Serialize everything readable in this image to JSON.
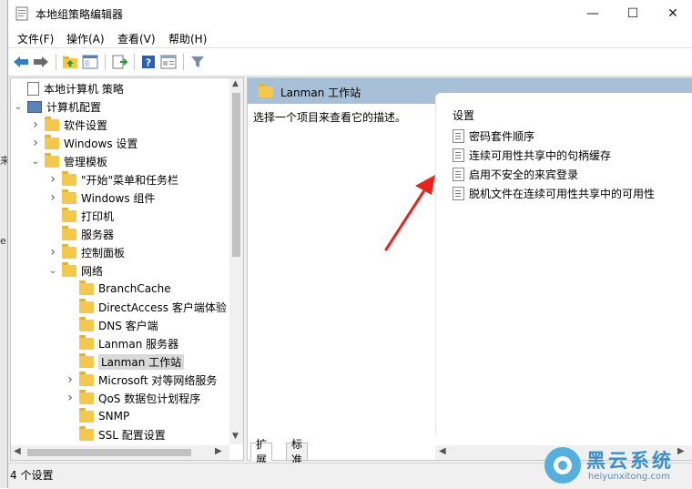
{
  "window": {
    "title": "本地组策略编辑器",
    "minimize_glyph": "—",
    "maximize_glyph": "☐",
    "close_glyph": "✕"
  },
  "menu": [
    "文件(F)",
    "操作(A)",
    "查看(V)",
    "帮助(H)"
  ],
  "toolbar_icons": [
    "back-icon",
    "forward-icon",
    "up-folder-icon",
    "show-hide-tree-icon",
    "export-list-icon",
    "help-icon",
    "properties-icon",
    "filter-icon"
  ],
  "left_strip_fragments": [
    "来",
    "e"
  ],
  "tree": {
    "nodes": [
      {
        "label": "本地计算机 策略",
        "depth": 0,
        "chevron": "",
        "icon": "policy-doc-icon"
      },
      {
        "label": "计算机配置",
        "depth": 0,
        "chevron": "v",
        "icon": "computer-icon"
      },
      {
        "label": "软件设置",
        "depth": 1,
        "chevron": ">",
        "icon": "folder-icon"
      },
      {
        "label": "Windows 设置",
        "depth": 1,
        "chevron": ">",
        "icon": "folder-icon"
      },
      {
        "label": "管理模板",
        "depth": 1,
        "chevron": "v",
        "icon": "folder-icon"
      },
      {
        "label": "\"开始\"菜单和任务栏",
        "depth": 2,
        "chevron": ">",
        "icon": "folder-icon"
      },
      {
        "label": "Windows 组件",
        "depth": 2,
        "chevron": ">",
        "icon": "folder-icon"
      },
      {
        "label": "打印机",
        "depth": 2,
        "chevron": "",
        "icon": "folder-icon"
      },
      {
        "label": "服务器",
        "depth": 2,
        "chevron": "",
        "icon": "folder-icon"
      },
      {
        "label": "控制面板",
        "depth": 2,
        "chevron": ">",
        "icon": "folder-icon"
      },
      {
        "label": "网络",
        "depth": 2,
        "chevron": "v",
        "icon": "folder-icon"
      },
      {
        "label": "BranchCache",
        "depth": 3,
        "chevron": "",
        "icon": "folder-icon"
      },
      {
        "label": "DirectAccess 客户端体验",
        "depth": 3,
        "chevron": "",
        "icon": "folder-icon"
      },
      {
        "label": "DNS 客户端",
        "depth": 3,
        "chevron": "",
        "icon": "folder-icon"
      },
      {
        "label": "Lanman 服务器",
        "depth": 3,
        "chevron": "",
        "icon": "folder-icon"
      },
      {
        "label": "Lanman 工作站",
        "depth": 3,
        "chevron": "",
        "icon": "folder-icon",
        "selected": true
      },
      {
        "label": "Microsoft 对等网络服务",
        "depth": 3,
        "chevron": ">",
        "icon": "folder-icon"
      },
      {
        "label": "QoS 数据包计划程序",
        "depth": 3,
        "chevron": ">",
        "icon": "folder-icon"
      },
      {
        "label": "SNMP",
        "depth": 3,
        "chevron": "",
        "icon": "folder-icon"
      },
      {
        "label": "SSL 配置设置",
        "depth": 3,
        "chevron": "",
        "icon": "folder-icon"
      }
    ]
  },
  "right_pane": {
    "header": "Lanman 工作站",
    "description": "选择一个项目来查看它的描述。",
    "column_header": "设置",
    "settings": [
      "密码套件顺序",
      "连续可用性共享中的句柄缓存",
      "启用不安全的来宾登录",
      "脱机文件在连续可用性共享中的可用性"
    ]
  },
  "tabs": [
    "扩展",
    "标准"
  ],
  "status": "4 个设置",
  "watermark": {
    "brand": "黑云系统",
    "url": "heiyunxitong.com"
  },
  "colors": {
    "header_blue": "#a8bfd8",
    "folder_yellow": "#f3c84b",
    "arrow_red": "#e8241e"
  }
}
